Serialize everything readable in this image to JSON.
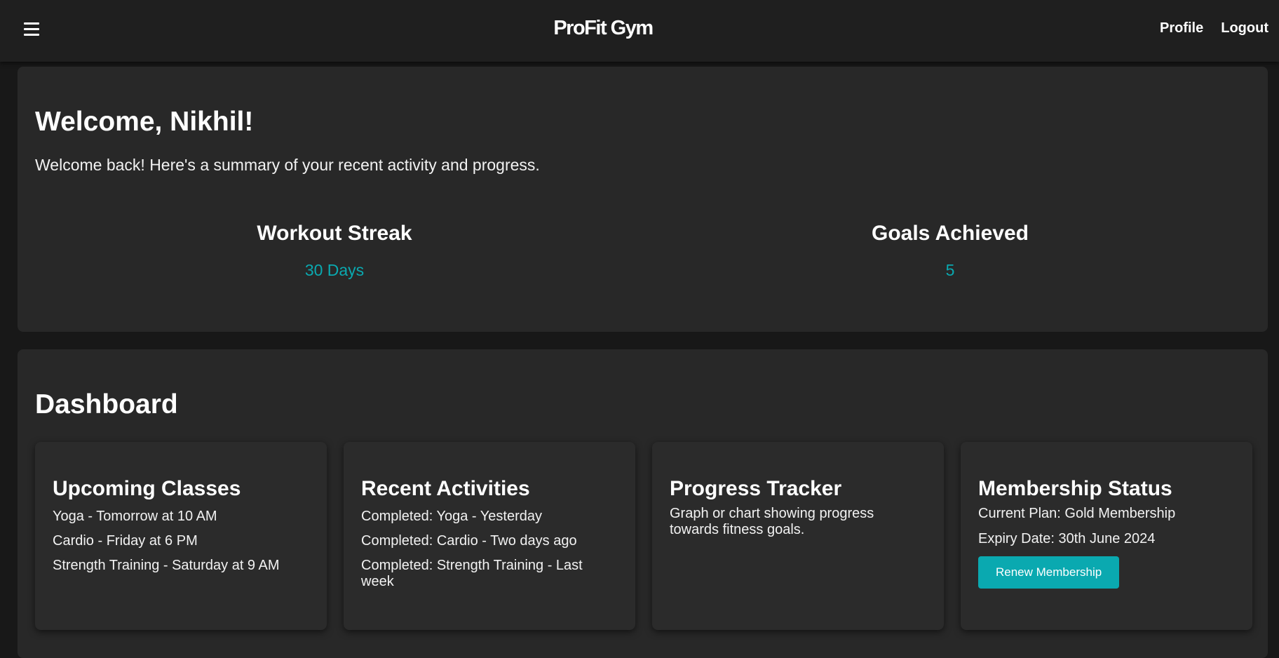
{
  "header": {
    "brand": "ProFit Gym",
    "menu_icon": "hamburger-menu-icon",
    "nav": [
      "Profile",
      "Logout"
    ]
  },
  "welcome": {
    "title": "Welcome, Nikhil!",
    "subtitle": "Welcome back! Here's a summary of your recent activity and progress.",
    "stats": [
      {
        "label": "Workout Streak",
        "value": "30 Days"
      },
      {
        "label": "Goals Achieved",
        "value": "5"
      }
    ]
  },
  "dashboard": {
    "title": "Dashboard",
    "cards": {
      "upcoming": {
        "title": "Upcoming Classes",
        "items": [
          "Yoga - Tomorrow at 10 AM",
          "Cardio - Friday at 6 PM",
          "Strength Training - Saturday at 9 AM"
        ]
      },
      "recent": {
        "title": "Recent Activities",
        "items": [
          "Completed: Yoga - Yesterday",
          "Completed: Cardio - Two days ago",
          "Completed: Strength Training - Last week"
        ]
      },
      "progress": {
        "title": "Progress Tracker",
        "text": "Graph or chart showing progress towards fitness goals."
      },
      "membership": {
        "title": "Membership Status",
        "plan": "Current Plan: Gold Membership",
        "expiry": "Expiry Date: 30th June 2024",
        "button": "Renew Membership"
      }
    }
  },
  "colors": {
    "accent": "#0aa9b0",
    "background": "#181818",
    "panel": "#282828",
    "header": "#1f1f1f"
  }
}
